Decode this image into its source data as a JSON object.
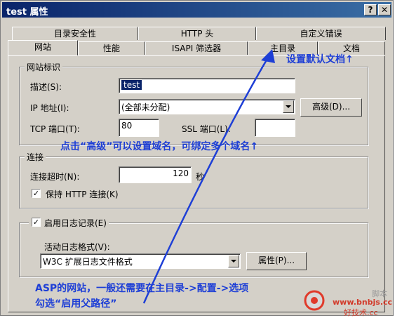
{
  "window": {
    "title": "test 属性",
    "help_btn": "?",
    "close_btn": "✕"
  },
  "tabs_row1": [
    "目录安全性",
    "HTTP 头",
    "自定义错误"
  ],
  "tabs_row2": [
    "网站",
    "性能",
    "ISAPI 筛选器",
    "主目录",
    "文档"
  ],
  "site_id": {
    "title": "网站标识",
    "desc_label": "描述(S):",
    "desc_value": "test",
    "ip_label": "IP 地址(I):",
    "ip_value": "(全部未分配)",
    "advanced_btn": "高级(D)...",
    "tcp_label": "TCP 端口(T):",
    "tcp_value": "80",
    "ssl_label": "SSL 端口(L):",
    "ssl_value": ""
  },
  "connection": {
    "title": "连接",
    "timeout_label": "连接超时(N):",
    "timeout_value": "120",
    "timeout_unit": "秒",
    "keepalive_label": "保持 HTTP 连接(K)",
    "keepalive_checked": true
  },
  "logging": {
    "enable_label": "启用日志记录(E)",
    "enabled": true,
    "format_label": "活动日志格式(V):",
    "format_value": "W3C 扩展日志文件格式",
    "properties_btn": "属性(P)..."
  },
  "annotations": {
    "default_doc": "设置默认文档↑",
    "advanced_note": "点击“高级”可以设置域名，可绑定多个域名↑",
    "asp_line1": "ASP的网站，一般还需要在主目录->配置->选项",
    "asp_line2": "勾选“启用父路径”",
    "color": "#1e3fd6"
  },
  "watermark": {
    "text1": "脚本",
    "text2": "www.bnbjs.cc",
    "text3": "好技术.cc"
  }
}
